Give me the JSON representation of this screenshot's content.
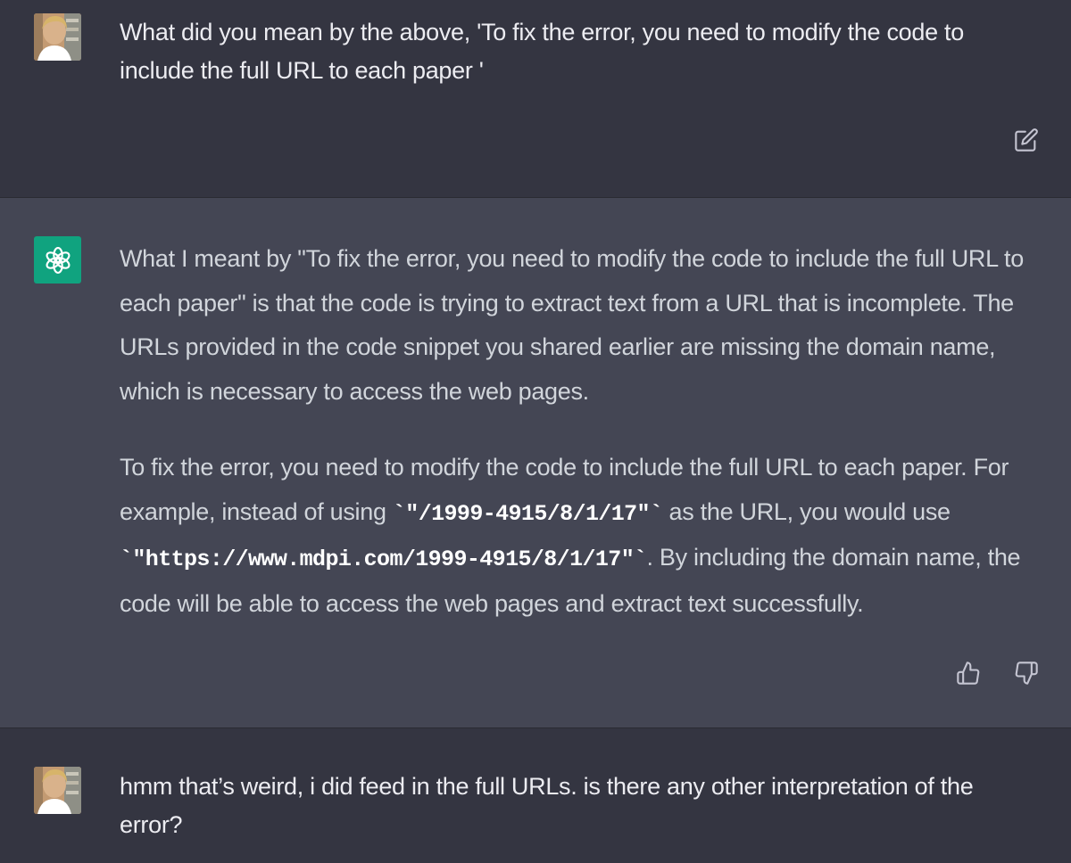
{
  "messages": [
    {
      "role": "user",
      "avatar_icon": "user-photo",
      "text": "What did you mean by the above, 'To fix the error, you need to modify the code to include the full URL to each paper '",
      "actions": [
        "edit-icon"
      ]
    },
    {
      "role": "assistant",
      "avatar_icon": "openai-logo-icon",
      "paragraph_1": "What I meant by \"To fix the error, you need to modify the code to include the full URL to each paper\" is that the code is trying to extract text from a URL that is incomplete. The URLs provided in the code snippet you shared earlier are missing the domain name, which is necessary to access the web pages.",
      "paragraph_2": {
        "part_1": "To fix the error, you need to modify the code to include the full URL to each paper. For example, instead of using ",
        "code_1": "`\"/1999-4915/8/1/17\"`",
        "part_2": " as the URL, you would use ",
        "code_2": "`\"https://www.mdpi.com/1999-4915/8/1/17\"`",
        "part_3": ". By including the domain name, the code will be able to access the web pages and extract text successfully."
      },
      "actions": [
        "thumbs-up-icon",
        "thumbs-down-icon"
      ]
    },
    {
      "role": "user",
      "avatar_icon": "user-photo",
      "text": "hmm that’s weird, i did feed in the full URLs. is there any other interpretation of the error?"
    }
  ],
  "colors": {
    "user_bg": "#343541",
    "assistant_bg": "#444654",
    "gpt_avatar": "#10a37f",
    "text": "#ececf1"
  }
}
